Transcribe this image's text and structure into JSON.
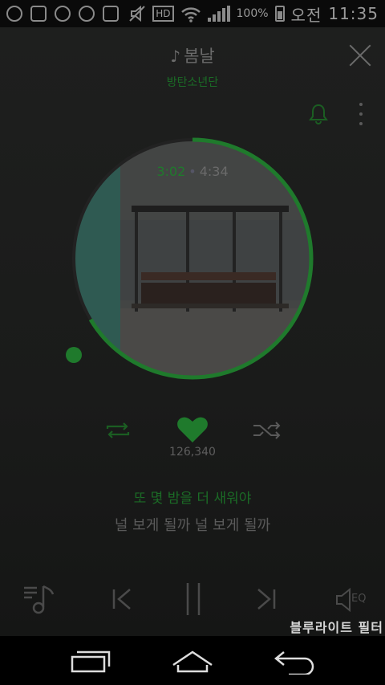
{
  "status_bar": {
    "battery_percent": "100%",
    "ampm": "오전",
    "time": "11:35",
    "hd_label": "HD",
    "icons": [
      "g-app-icon",
      "plus-app-icon",
      "camera-app-icon",
      "kt-app-icon",
      "youtube-icon",
      "mute-icon",
      "hd-icon",
      "wifi-icon",
      "signal-icon",
      "battery-icon"
    ]
  },
  "player": {
    "song_title": "봄날",
    "title_icon": "music-note-icon",
    "artist": "방탄소년단",
    "current_time": "3:02",
    "time_separator": "•",
    "total_time": "4:34",
    "progress_fraction": 0.664,
    "like_count": "126,340",
    "lyric_current": "또 몇 밤을 더 새워야",
    "lyric_next": "널 보게 될까 널 보게 될까",
    "accent_color": "#1f7a2c"
  },
  "overlay": {
    "filter_label": "블루라이트 필터"
  },
  "bottom_controls": {
    "eq_label": "EQ"
  },
  "nav_bar": {
    "items": [
      "recent-apps",
      "home",
      "back"
    ]
  }
}
